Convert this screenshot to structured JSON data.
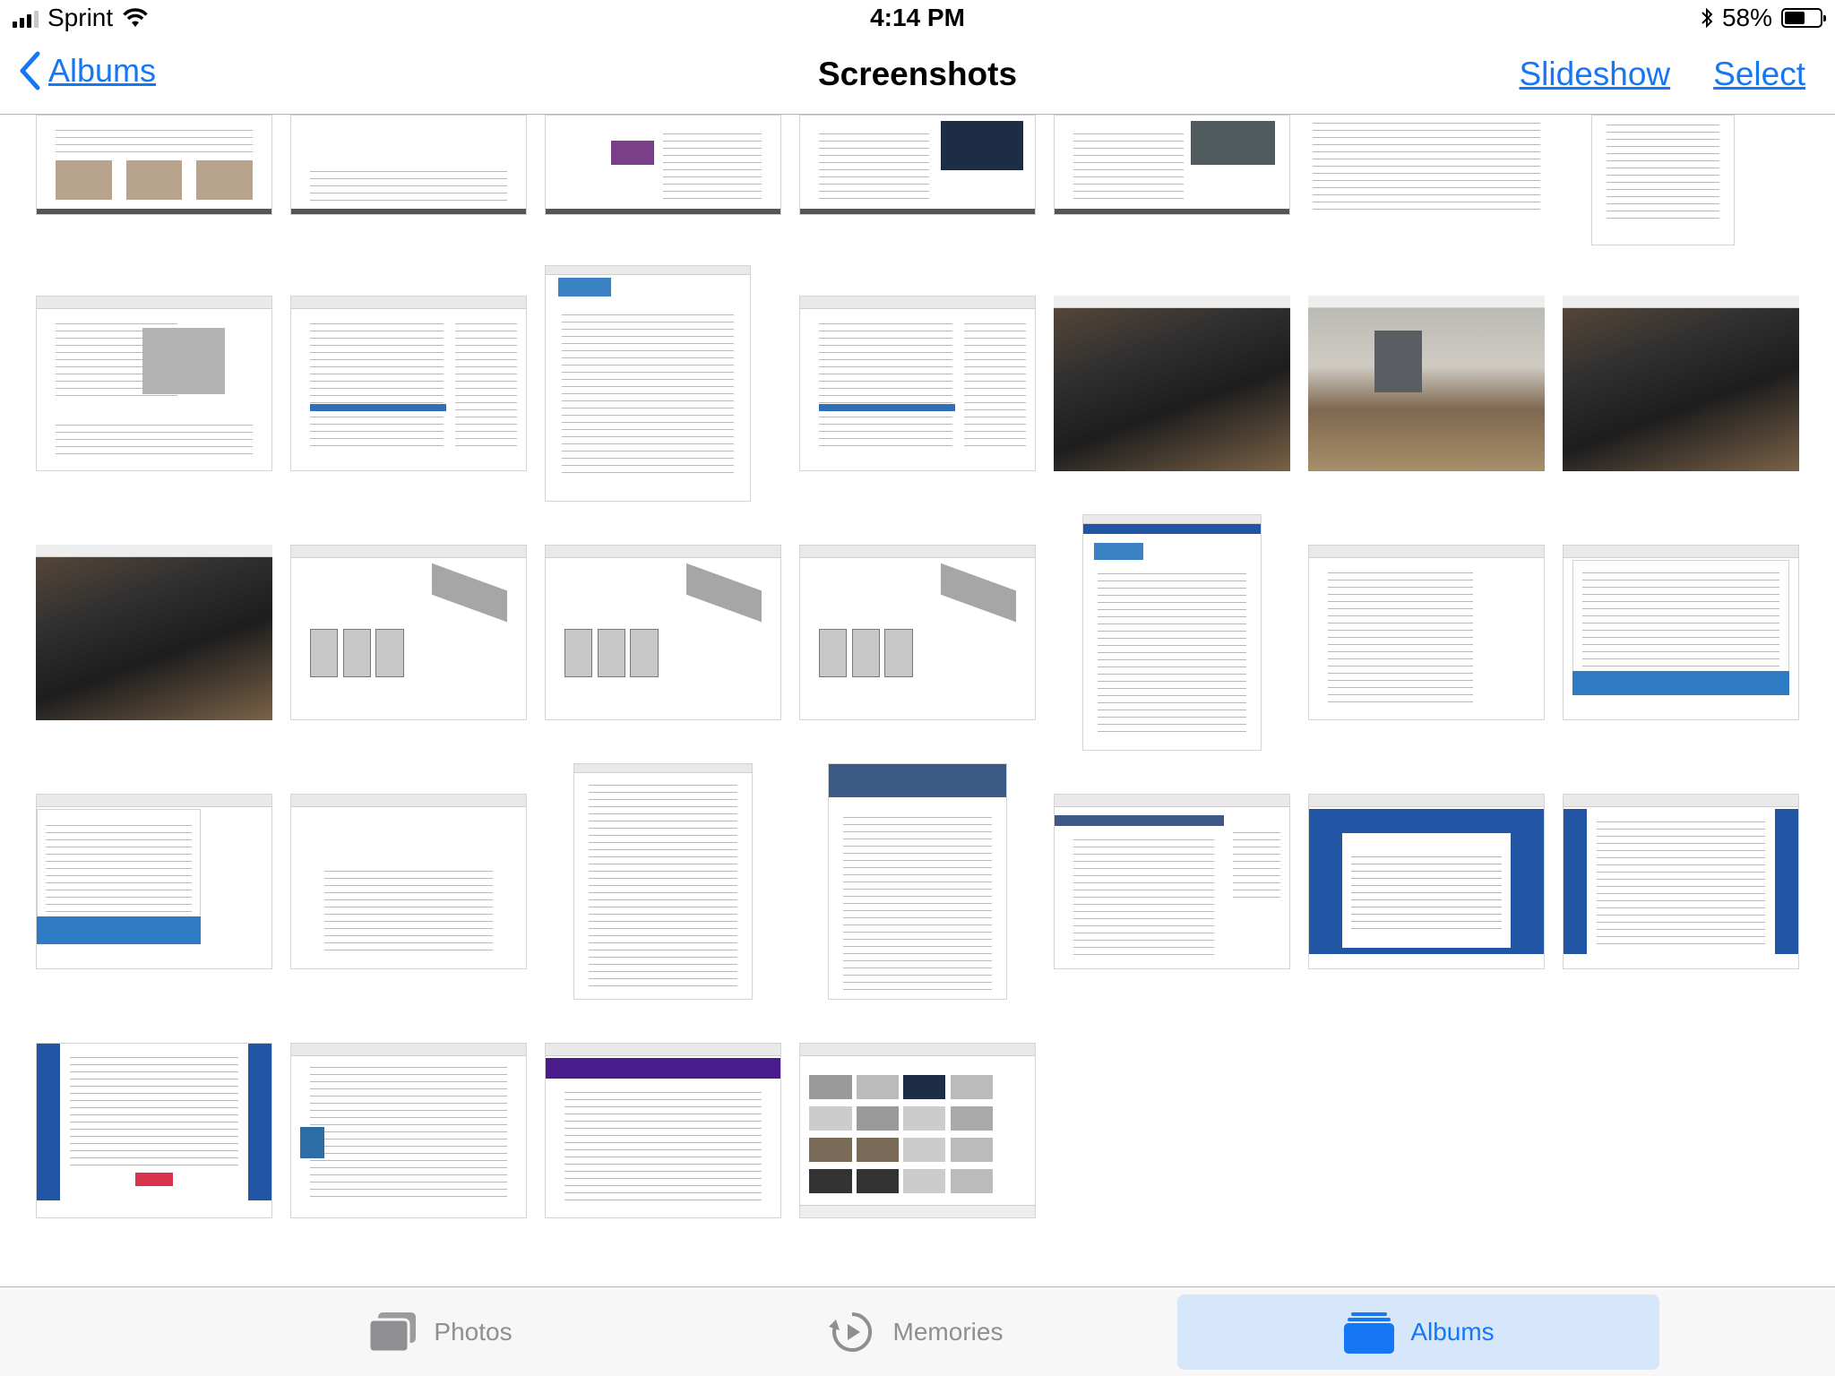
{
  "status_bar": {
    "carrier": "Sprint",
    "time": "4:14 PM",
    "battery_text": "58%",
    "battery_level": 0.58,
    "icons": [
      "signal-bars-icon",
      "wifi-icon",
      "bluetooth-icon",
      "battery-icon"
    ]
  },
  "nav": {
    "back_label": "Albums",
    "title": "Screenshots",
    "slideshow_label": "Slideshow",
    "select_label": "Select"
  },
  "tabs": [
    {
      "label": "Photos",
      "icon": "photos-stack-icon",
      "active": false
    },
    {
      "label": "Memories",
      "icon": "memories-icon",
      "active": false
    },
    {
      "label": "Albums",
      "icon": "albums-icon",
      "active": true
    }
  ],
  "colors": {
    "accent": "#1677f5",
    "tab_inactive": "#8e8e93",
    "tab_active_bg": "#d6e6fb"
  },
  "thumbnails": {
    "row1": [
      "document",
      "document",
      "document",
      "document",
      "document",
      "document",
      "document"
    ],
    "row2": [
      "signed-form",
      "form",
      "signed-letter",
      "form",
      "photo",
      "photo",
      "photo"
    ],
    "row3": [
      "photo",
      "drawing",
      "drawing",
      "drawing",
      "email",
      "email",
      "web-page"
    ],
    "row4": [
      "web-page",
      "web-page",
      "email",
      "web-page",
      "web-page",
      "web-form",
      "web-form"
    ],
    "row5": [
      "web-form",
      "email",
      "email",
      "photo-album"
    ]
  }
}
